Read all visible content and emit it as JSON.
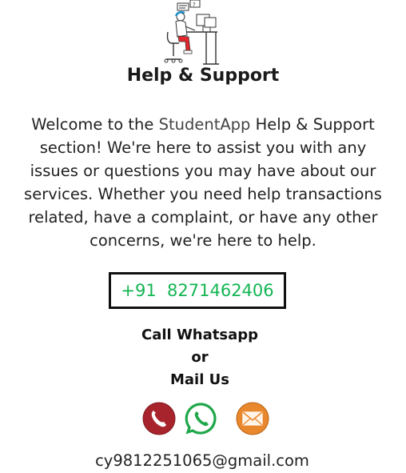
{
  "header": {
    "title": "Help & Support",
    "illustration_icon": "support-agent-at-desk-icon"
  },
  "intro": {
    "before_brand": "Welcome to the ",
    "brand": "StudentApp",
    "after_brand": " Help & Support section! We're here to assist you with any issues or questions you may have about our services. Whether you need help transactions related, have a complaint, or have any other concerns, we're here to help."
  },
  "contact": {
    "phone": "+91  8271462406",
    "line1": "Call Whatsapp",
    "line2": "or",
    "line3": "Mail Us",
    "email": "cy9812251065@gmail.com"
  },
  "icons": {
    "call": "phone-icon",
    "whatsapp": "whatsapp-icon",
    "mail": "mail-icon"
  },
  "colors": {
    "phone_text": "#13b552",
    "call_button": "#a8242c",
    "whatsapp": "#1fa74a",
    "mail_button": "#e8872c"
  }
}
